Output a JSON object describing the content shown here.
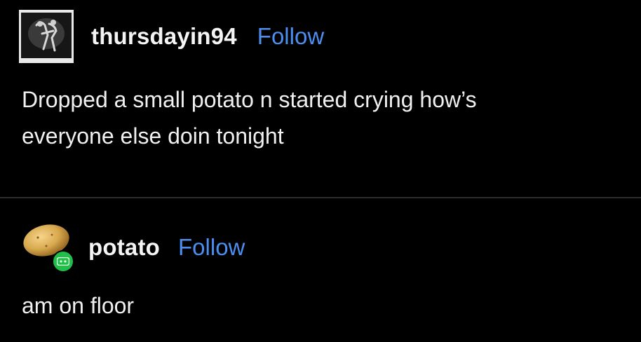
{
  "posts": [
    {
      "username": "thursdayin94",
      "follow_label": "Follow",
      "avatar_icon": "bw-photo-avatar",
      "body_lines": [
        "Dropped a small potato n started crying how’s",
        "everyone else doin tonight"
      ]
    },
    {
      "username": "potato",
      "follow_label": "Follow",
      "avatar_icon": "potato-avatar",
      "body_lines": [
        "am on floor"
      ]
    }
  ],
  "colors": {
    "background": "#000000",
    "text": "#f0f0f0",
    "follow": "#4b8ff0",
    "badge": "#1fbf4a",
    "divider": "#2c2c2e"
  }
}
